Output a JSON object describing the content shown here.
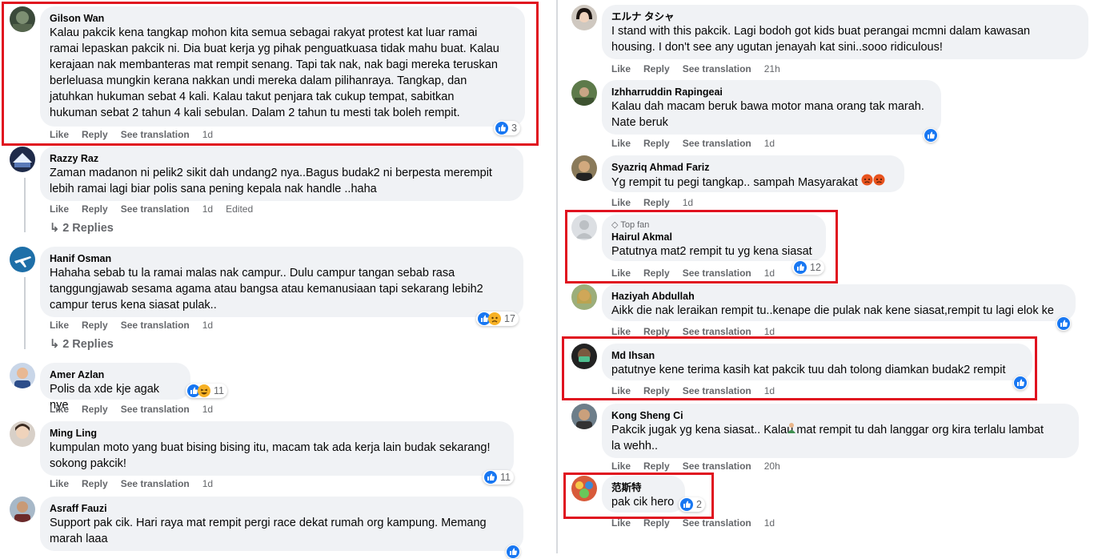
{
  "labels": {
    "like": "Like",
    "reply": "Reply",
    "see_translation": "See translation"
  },
  "colors": {
    "like_blue": "#1877f2",
    "highlight_red": "#e0121f",
    "bubble_bg": "#f0f2f5",
    "meta_gray": "#65676b"
  },
  "left": [
    {
      "name": "Gilson Wan",
      "lines": [
        "Kalau pakcik kena tangkap mohon kita semua sebagai rakyat protest kat luar ramai",
        "ramai lepaskan pakcik ni. Dia buat kerja yg pihak penguatkuasa tidak mahu buat. Kalau",
        "kerajaan nak membanteras mat rempit senang. Tapi tak nak, nak bagi mereka teruskan",
        "berleluasa mungkin kerana nakkan undi mereka dalam pilihanraya. Tangkap, dan",
        "jatuhkan hukuman sebat 4 kali. Kalau takut penjara tak cukup tempat, sabitkan",
        "hukuman sebat 2 tahun 4 kali sebulan. Dalam 2 tahun tu mesti tak boleh rempit."
      ],
      "time": "1d",
      "reaction_count": "3"
    },
    {
      "name": "Razzy Raz",
      "lines": [
        "Zaman madanon ni pelik2 sikit dah undang2 nya..Bagus budak2 ni berpesta merempit",
        "lebih ramai lagi biar polis sana pening kepala nak handle ..haha"
      ],
      "time": "1d",
      "edited": "Edited",
      "replies": "2 Replies"
    },
    {
      "name": "Hanif Osman",
      "lines": [
        "Hahaha sebab tu la ramai malas nak campur.. Dulu campur tangan sebab rasa",
        "tanggungjawab sesama agama atau bangsa atau kemanusiaan tapi sekarang lebih2",
        "campur terus kena siasat pulak.."
      ],
      "time": "1d",
      "reaction_count": "17",
      "replies": "2 Replies"
    },
    {
      "name": "Amer Azlan",
      "lines": [
        "Polis da xde kje agak nye"
      ],
      "time": "1d",
      "reaction_count": "11"
    },
    {
      "name": "Ming Ling",
      "lines": [
        "kumpulan moto yang buat bising bising itu, macam tak ada kerja lain budak sekarang!",
        "sokong pakcik!"
      ],
      "time": "1d",
      "reaction_count": "11"
    },
    {
      "name": "Asraff Fauzi",
      "lines": [
        "Support pak cik. Hari raya mat rempit pergi race dekat rumah org kampung. Memang",
        "marah laaa"
      ]
    }
  ],
  "right": [
    {
      "name": "エルナ タシャ",
      "lines": [
        "I stand with this pakcik. Lagi bodoh got kids buat perangai mcmni dalam kawasan",
        "housing. I don't see any ugutan jenayah kat sini..sooo ridiculous!"
      ],
      "time": "21h"
    },
    {
      "name": "Izhharruddin Rapingeai",
      "lines": [
        "Kalau dah macam beruk bawa motor mana orang tak marah.",
        "Nate beruk"
      ],
      "time": "1d"
    },
    {
      "name": "Syazriq Ahmad Fariz",
      "lines": [
        "Yg rempit tu pegi tangkap.. sampah Masyarakat"
      ],
      "time": "1d"
    },
    {
      "badge": "Top fan",
      "name": "Hairul Akmal",
      "lines": [
        "Patutnya mat2 rempit tu yg kena siasat"
      ],
      "time": "1d",
      "reaction_count": "12"
    },
    {
      "name": "Haziyah Abdullah",
      "lines": [
        "Aikk die nak leraikan rempit tu..kenape die pulak nak kene siasat,rempit tu lagi elok ke"
      ],
      "time": "1d"
    },
    {
      "name": "Md Ihsan",
      "lines": [
        "patutnye kene terima kasih kat pakcik tuu dah tolong diamkan budak2 rempit"
      ],
      "time": "1d"
    },
    {
      "name": "Kong Sheng Ci",
      "lines": [
        "Pakcik jugak yg kena siasat..  Kalau mat rempit tu dah langgar org kira terlalu lambat",
        "la wehh.."
      ],
      "time": "20h"
    },
    {
      "name": "范斯特",
      "lines": [
        "pak cik hero"
      ],
      "time": "1d",
      "reaction_count": "2"
    }
  ]
}
